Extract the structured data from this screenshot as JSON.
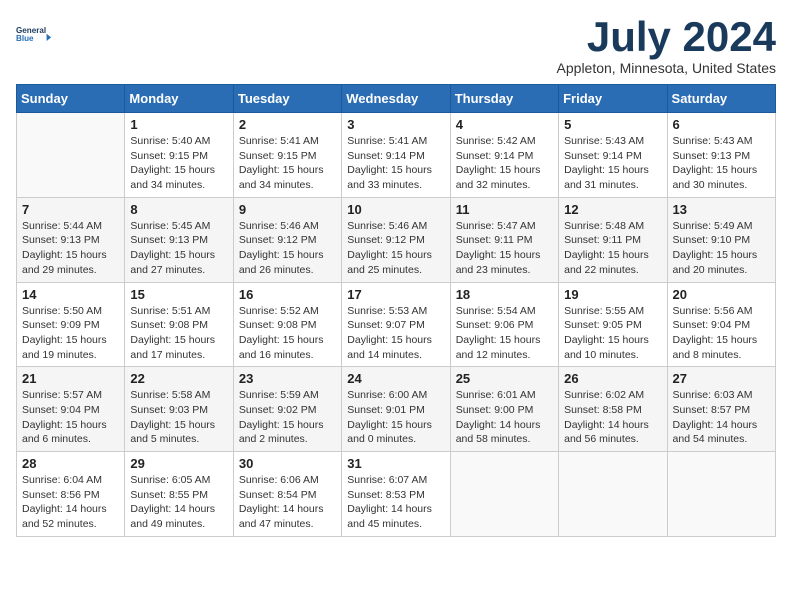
{
  "header": {
    "logo_line1": "General",
    "logo_line2": "Blue",
    "month_title": "July 2024",
    "location": "Appleton, Minnesota, United States"
  },
  "weekdays": [
    "Sunday",
    "Monday",
    "Tuesday",
    "Wednesday",
    "Thursday",
    "Friday",
    "Saturday"
  ],
  "weeks": [
    [
      {
        "num": "",
        "sunrise": "",
        "sunset": "",
        "daylight": ""
      },
      {
        "num": "1",
        "sunrise": "Sunrise: 5:40 AM",
        "sunset": "Sunset: 9:15 PM",
        "daylight": "Daylight: 15 hours and 34 minutes."
      },
      {
        "num": "2",
        "sunrise": "Sunrise: 5:41 AM",
        "sunset": "Sunset: 9:15 PM",
        "daylight": "Daylight: 15 hours and 34 minutes."
      },
      {
        "num": "3",
        "sunrise": "Sunrise: 5:41 AM",
        "sunset": "Sunset: 9:14 PM",
        "daylight": "Daylight: 15 hours and 33 minutes."
      },
      {
        "num": "4",
        "sunrise": "Sunrise: 5:42 AM",
        "sunset": "Sunset: 9:14 PM",
        "daylight": "Daylight: 15 hours and 32 minutes."
      },
      {
        "num": "5",
        "sunrise": "Sunrise: 5:43 AM",
        "sunset": "Sunset: 9:14 PM",
        "daylight": "Daylight: 15 hours and 31 minutes."
      },
      {
        "num": "6",
        "sunrise": "Sunrise: 5:43 AM",
        "sunset": "Sunset: 9:13 PM",
        "daylight": "Daylight: 15 hours and 30 minutes."
      }
    ],
    [
      {
        "num": "7",
        "sunrise": "Sunrise: 5:44 AM",
        "sunset": "Sunset: 9:13 PM",
        "daylight": "Daylight: 15 hours and 29 minutes."
      },
      {
        "num": "8",
        "sunrise": "Sunrise: 5:45 AM",
        "sunset": "Sunset: 9:13 PM",
        "daylight": "Daylight: 15 hours and 27 minutes."
      },
      {
        "num": "9",
        "sunrise": "Sunrise: 5:46 AM",
        "sunset": "Sunset: 9:12 PM",
        "daylight": "Daylight: 15 hours and 26 minutes."
      },
      {
        "num": "10",
        "sunrise": "Sunrise: 5:46 AM",
        "sunset": "Sunset: 9:12 PM",
        "daylight": "Daylight: 15 hours and 25 minutes."
      },
      {
        "num": "11",
        "sunrise": "Sunrise: 5:47 AM",
        "sunset": "Sunset: 9:11 PM",
        "daylight": "Daylight: 15 hours and 23 minutes."
      },
      {
        "num": "12",
        "sunrise": "Sunrise: 5:48 AM",
        "sunset": "Sunset: 9:11 PM",
        "daylight": "Daylight: 15 hours and 22 minutes."
      },
      {
        "num": "13",
        "sunrise": "Sunrise: 5:49 AM",
        "sunset": "Sunset: 9:10 PM",
        "daylight": "Daylight: 15 hours and 20 minutes."
      }
    ],
    [
      {
        "num": "14",
        "sunrise": "Sunrise: 5:50 AM",
        "sunset": "Sunset: 9:09 PM",
        "daylight": "Daylight: 15 hours and 19 minutes."
      },
      {
        "num": "15",
        "sunrise": "Sunrise: 5:51 AM",
        "sunset": "Sunset: 9:08 PM",
        "daylight": "Daylight: 15 hours and 17 minutes."
      },
      {
        "num": "16",
        "sunrise": "Sunrise: 5:52 AM",
        "sunset": "Sunset: 9:08 PM",
        "daylight": "Daylight: 15 hours and 16 minutes."
      },
      {
        "num": "17",
        "sunrise": "Sunrise: 5:53 AM",
        "sunset": "Sunset: 9:07 PM",
        "daylight": "Daylight: 15 hours and 14 minutes."
      },
      {
        "num": "18",
        "sunrise": "Sunrise: 5:54 AM",
        "sunset": "Sunset: 9:06 PM",
        "daylight": "Daylight: 15 hours and 12 minutes."
      },
      {
        "num": "19",
        "sunrise": "Sunrise: 5:55 AM",
        "sunset": "Sunset: 9:05 PM",
        "daylight": "Daylight: 15 hours and 10 minutes."
      },
      {
        "num": "20",
        "sunrise": "Sunrise: 5:56 AM",
        "sunset": "Sunset: 9:04 PM",
        "daylight": "Daylight: 15 hours and 8 minutes."
      }
    ],
    [
      {
        "num": "21",
        "sunrise": "Sunrise: 5:57 AM",
        "sunset": "Sunset: 9:04 PM",
        "daylight": "Daylight: 15 hours and 6 minutes."
      },
      {
        "num": "22",
        "sunrise": "Sunrise: 5:58 AM",
        "sunset": "Sunset: 9:03 PM",
        "daylight": "Daylight: 15 hours and 5 minutes."
      },
      {
        "num": "23",
        "sunrise": "Sunrise: 5:59 AM",
        "sunset": "Sunset: 9:02 PM",
        "daylight": "Daylight: 15 hours and 2 minutes."
      },
      {
        "num": "24",
        "sunrise": "Sunrise: 6:00 AM",
        "sunset": "Sunset: 9:01 PM",
        "daylight": "Daylight: 15 hours and 0 minutes."
      },
      {
        "num": "25",
        "sunrise": "Sunrise: 6:01 AM",
        "sunset": "Sunset: 9:00 PM",
        "daylight": "Daylight: 14 hours and 58 minutes."
      },
      {
        "num": "26",
        "sunrise": "Sunrise: 6:02 AM",
        "sunset": "Sunset: 8:58 PM",
        "daylight": "Daylight: 14 hours and 56 minutes."
      },
      {
        "num": "27",
        "sunrise": "Sunrise: 6:03 AM",
        "sunset": "Sunset: 8:57 PM",
        "daylight": "Daylight: 14 hours and 54 minutes."
      }
    ],
    [
      {
        "num": "28",
        "sunrise": "Sunrise: 6:04 AM",
        "sunset": "Sunset: 8:56 PM",
        "daylight": "Daylight: 14 hours and 52 minutes."
      },
      {
        "num": "29",
        "sunrise": "Sunrise: 6:05 AM",
        "sunset": "Sunset: 8:55 PM",
        "daylight": "Daylight: 14 hours and 49 minutes."
      },
      {
        "num": "30",
        "sunrise": "Sunrise: 6:06 AM",
        "sunset": "Sunset: 8:54 PM",
        "daylight": "Daylight: 14 hours and 47 minutes."
      },
      {
        "num": "31",
        "sunrise": "Sunrise: 6:07 AM",
        "sunset": "Sunset: 8:53 PM",
        "daylight": "Daylight: 14 hours and 45 minutes."
      },
      {
        "num": "",
        "sunrise": "",
        "sunset": "",
        "daylight": ""
      },
      {
        "num": "",
        "sunrise": "",
        "sunset": "",
        "daylight": ""
      },
      {
        "num": "",
        "sunrise": "",
        "sunset": "",
        "daylight": ""
      }
    ]
  ]
}
